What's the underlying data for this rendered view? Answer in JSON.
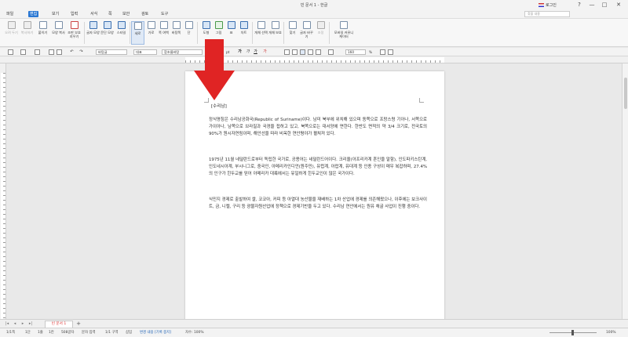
{
  "app": {
    "title": "빈 문서 1 - 한글",
    "login_label": "로그인",
    "window_controls": [
      "?",
      "—",
      "□",
      "✕"
    ]
  },
  "menu": {
    "file": "파일",
    "items": [
      "편집",
      "보기",
      "입력",
      "서식",
      "쪽",
      "보안",
      "검토",
      "도구"
    ],
    "active": "편집",
    "help_placeholder": "찾을 내용"
  },
  "ribbon": {
    "buttons": [
      {
        "label": "오려 두기",
        "icon": "scissors-icon"
      },
      {
        "label": "복사하기",
        "icon": "copy-icon"
      },
      {
        "label": "붙이기",
        "icon": "paste-icon"
      },
      {
        "label": "모양 복사",
        "icon": "format-painter-icon"
      },
      {
        "label": "조판 부호 지우기",
        "icon": "clear-format-icon"
      },
      {
        "label": "글자 모양",
        "icon": "char-shape-icon"
      },
      {
        "label": "문단 모양",
        "icon": "para-shape-icon"
      },
      {
        "label": "스타일",
        "icon": "style-icon"
      },
      {
        "label": "세로",
        "icon": "portrait-icon"
      },
      {
        "label": "가로",
        "icon": "landscape-icon"
      },
      {
        "label": "쪽 여백",
        "icon": "page-margin-icon"
      },
      {
        "label": "바탕쪽",
        "icon": "master-page-icon"
      },
      {
        "label": "단",
        "icon": "columns-icon"
      },
      {
        "label": "도형",
        "icon": "shape-icon"
      },
      {
        "label": "그림",
        "icon": "picture-icon"
      },
      {
        "label": "표",
        "icon": "table-icon"
      },
      {
        "label": "차트",
        "icon": "chart-icon"
      },
      {
        "label": "개체 선택",
        "icon": "object-select-icon"
      },
      {
        "label": "개체 보호",
        "icon": "object-protect-icon"
      },
      {
        "label": "찾기",
        "icon": "find-icon"
      },
      {
        "label": "글자 바꾸기",
        "icon": "replace-icon"
      },
      {
        "label": "조정",
        "icon": "adjust-icon"
      },
      {
        "label": "모바일 커뮤니케이터",
        "icon": "mobile-icon"
      }
    ]
  },
  "toolbar2": {
    "style_name": "바탕글",
    "font_lang": "대표",
    "font_name": "함초롬바탕",
    "font_size_unit": "pt",
    "zoom": "160",
    "zoom_unit": "%"
  },
  "document": {
    "heading": "[수리남]",
    "paragraphs": [
      "정식명칭은 수리남공화국(Republic of Suriname)이다. 남미 북부에 위치해 있으며 동쪽으로 프랑스령 기아나, 서쪽으로 가이아나, 남쪽으로 브라질과 국경을 접하고 있고, 북쪽으로는 대서양에 면한다. 한반도 면적의 약 3/4 크기로, 전국토의 90%가 원시자연림이며, 해안선을 따라 비옥한 연안평야가 펼쳐져 있다.",
      "1975년 11월 네덜란드로부터 독립한 국가로, 공용어는 네덜란드어이다. 크리올(아프리카계 혼인을 말함), 인도파키스탄계, 인도네시아계, 부시니그로, 중국인, 아메리카인디언(원주민), 유럽계, 아랍계, 유대계 등 인종 구성이 매우 복잡하며, 27.4%의 인구가 힌두교를 믿어 아메리카 대륙에서는 유일하게 힌두교인이 많은 국가이다.",
      "식민지 경제로 출발하여 쌀, 코코아, 커피 등 아열대 농산물을 재배하는 1차 산업에 경제를 의존해왔으나, 이후에는 보크사이트, 금, 니켈, 구리 등 광물자원산업에 정책으로 경제기반을 두고 있다. 수리남 연안에서는 원유 채굴 사업이 진행 중이다."
    ]
  },
  "tabs": {
    "doc_tab": "빈 문서 1",
    "add": "+"
  },
  "status": {
    "page": "1/1쪽",
    "section": "1단",
    "line": "1줄",
    "col": "1칸",
    "chars": "508글자",
    "mode": "문자 입력",
    "zone": "1/1 구역",
    "insert": "삽입",
    "track": "변경 내용 [기록 중지]",
    "tracking_label": "자수: 100%",
    "zoom": "100%"
  },
  "colors": {
    "accent": "#2b78d3",
    "arrow": "#e02424"
  }
}
